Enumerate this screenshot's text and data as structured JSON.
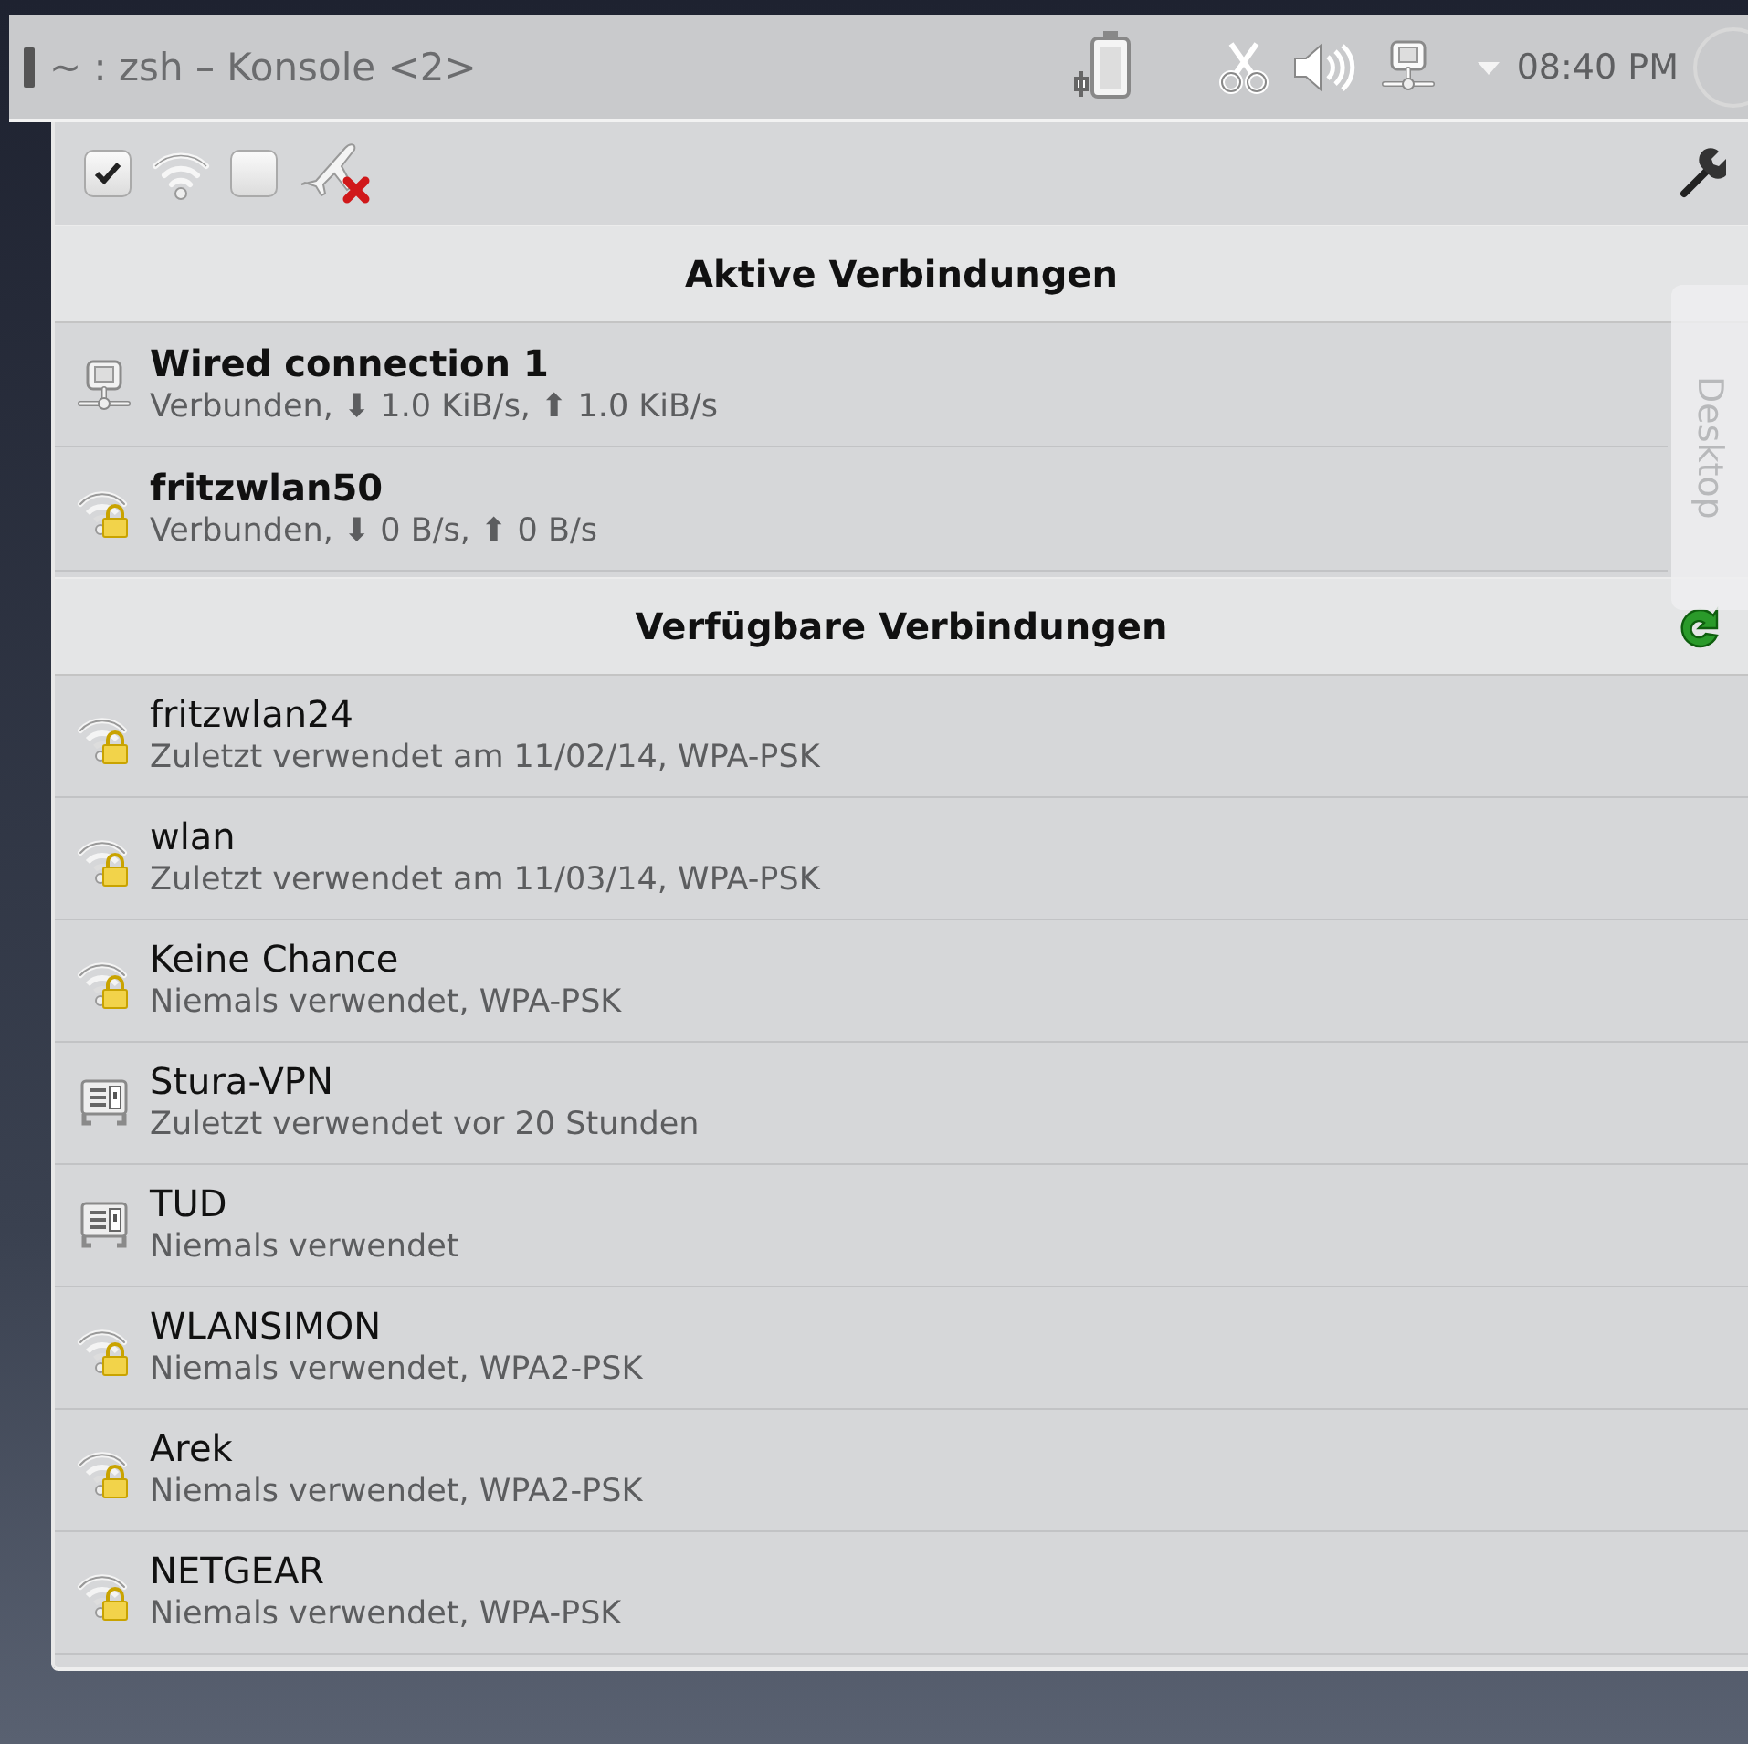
{
  "panel": {
    "task": "~ : zsh – Konsole <2>",
    "clock": "08:40 PM"
  },
  "toggles": [
    {
      "kind": "wifi",
      "checked": true
    },
    {
      "kind": "airplane",
      "checked": false
    }
  ],
  "sections": [
    {
      "title": "Aktive Verbindungen",
      "active": true,
      "refresh": false,
      "connections": [
        {
          "kind": "wired",
          "name": "Wired connection 1",
          "detail": "Verbunden, ⬇ 1.0 KiB/s, ⬆ 1.0 KiB/s"
        },
        {
          "kind": "wifi",
          "name": "fritzwlan50",
          "detail": "Verbunden, ⬇ 0 B/s, ⬆ 0 B/s"
        }
      ]
    },
    {
      "title": "Verfügbare Verbindungen",
      "active": false,
      "refresh": true,
      "connections": [
        {
          "kind": "wifi",
          "name": "fritzwlan24",
          "detail": "Zuletzt verwendet am 11/02/14, WPA-PSK"
        },
        {
          "kind": "wifi",
          "name": "wlan",
          "detail": "Zuletzt verwendet am 11/03/14, WPA-PSK"
        },
        {
          "kind": "wifi",
          "name": "Keine Chance",
          "detail": "Niemals verwendet, WPA-PSK"
        },
        {
          "kind": "vpn",
          "name": "Stura-VPN",
          "detail": "Zuletzt verwendet vor 20 Stunden"
        },
        {
          "kind": "vpn",
          "name": "TUD",
          "detail": "Niemals verwendet"
        },
        {
          "kind": "wifi",
          "name": "WLANSIMON",
          "detail": "Niemals verwendet, WPA2-PSK"
        },
        {
          "kind": "wifi",
          "name": "Arek",
          "detail": "Niemals verwendet, WPA2-PSK"
        },
        {
          "kind": "wifi",
          "name": "NETGEAR",
          "detail": "Niemals verwendet, WPA-PSK"
        }
      ]
    }
  ],
  "desktop_tab": {
    "label": "Desktop"
  }
}
